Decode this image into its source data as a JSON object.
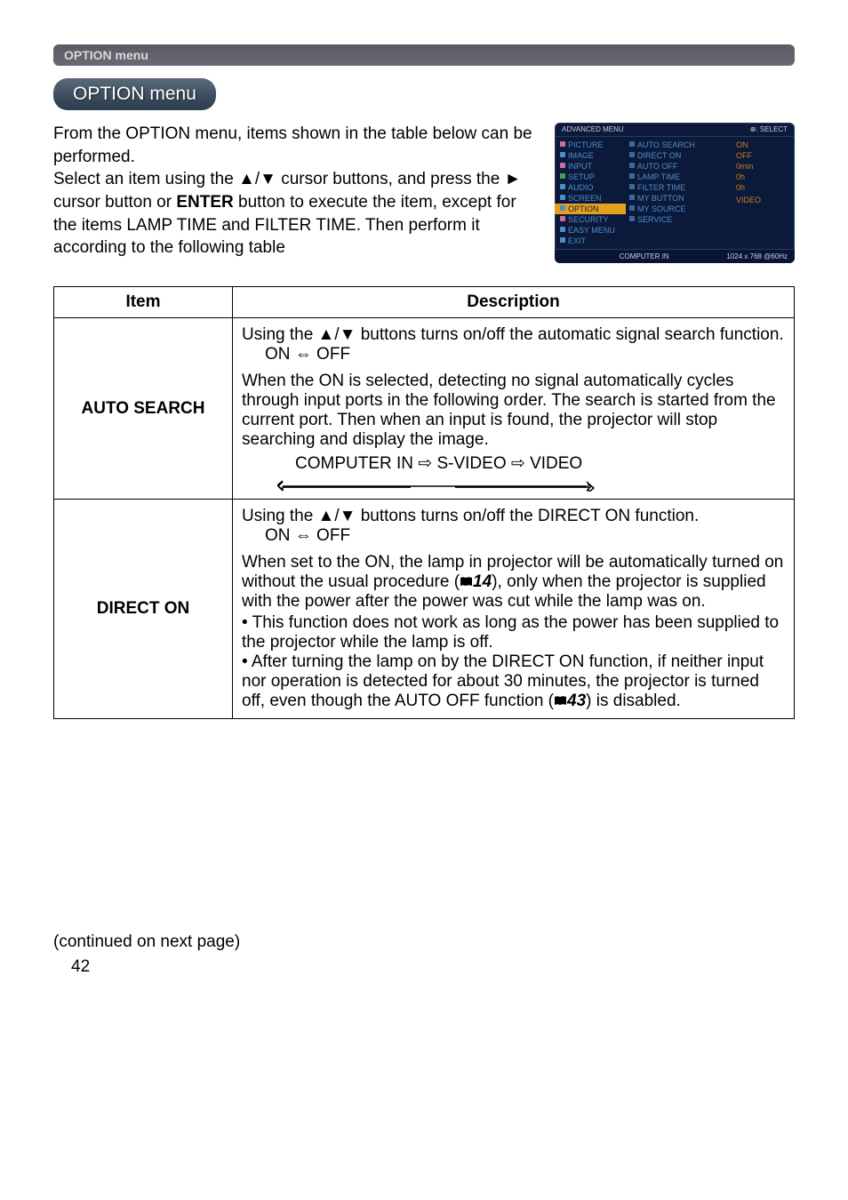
{
  "header": {
    "banner": "OPTION menu",
    "title": "OPTION menu"
  },
  "intro": "From the OPTION menu, items shown in the table below can be performed.\nSelect an item using the ▲/▼ cursor buttons, and press the ► cursor button or ENTER button to execute the item, except for the items LAMP TIME and FILTER TIME. Then perform it according to the following table",
  "osd": {
    "top_left": "ADVANCED MENU",
    "top_right": "⊕: SELECT",
    "left": [
      "PICTURE",
      "IMAGE",
      "INPUT",
      "SETUP",
      "AUDIO",
      "SCREEN",
      "OPTION",
      "SECURITY",
      "EASY MENU",
      "EXIT"
    ],
    "mid": [
      "AUTO SEARCH",
      "DIRECT ON",
      "AUTO OFF",
      "LAMP TIME",
      "FILTER TIME",
      "MY BUTTON",
      "MY SOURCE",
      "SERVICE"
    ],
    "right": [
      "ON",
      "OFF",
      "0min",
      "0h",
      "0h",
      "",
      "VIDEO",
      ""
    ],
    "bottom_left": "",
    "bottom_mid": "COMPUTER IN",
    "bottom_right": "1024 x 768 @60Hz"
  },
  "table": {
    "col1": "Item",
    "col2": "Description",
    "rows": [
      {
        "item": "AUTO SEARCH",
        "d1": "Using the ▲/▼ buttons turns on/off the automatic signal search function.",
        "d2": "ON ⇔ OFF",
        "d3": "When the ON is selected, detecting no signal automatically cycles through input ports in the following order. The search is started from the current port. Then when an input is found, the projector will stop searching and display the image.",
        "d4": "COMPUTER IN ⇨ S-VIDEO ⇨ VIDEO"
      },
      {
        "item": "DIRECT ON",
        "d1": "Using the ▲/▼ buttons turns on/off the DIRECT ON function.",
        "d2": "ON ⇔ OFF",
        "d3a": "When set to the ON, the lamp in projector will be automatically turned on without the usual procedure (",
        "d3b": "14",
        "d3c": "), only when the projector is supplied with the power after the power was cut while the lamp was on.",
        "d4": "• This function does not work as long as the power has been supplied to the projector while the lamp is off.",
        "d5a": "• After turning the lamp on by the DIRECT ON function, if neither input nor operation is detected for about 30 minutes, the projector is turned off, even though the AUTO OFF function (",
        "d5b": "43",
        "d5c": ") is disabled."
      }
    ]
  },
  "footer": {
    "continued": "(continued on next page)",
    "page": "42"
  }
}
